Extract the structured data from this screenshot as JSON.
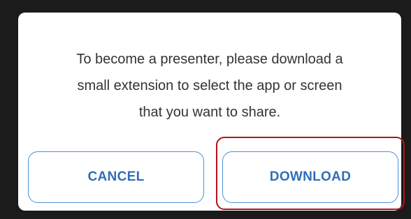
{
  "dialog": {
    "message_lines": [
      "To become a presenter, please download a",
      "small extension to select the app or screen",
      "that you want to share."
    ],
    "cancel_label": "CANCEL",
    "download_label": "DOWNLOAD"
  },
  "colors": {
    "backdrop": "#1b1b1b",
    "dialog_bg": "#ffffff",
    "button_border": "#4a90d9",
    "button_text": "#2f6fb5",
    "highlight": "#b0141c"
  }
}
